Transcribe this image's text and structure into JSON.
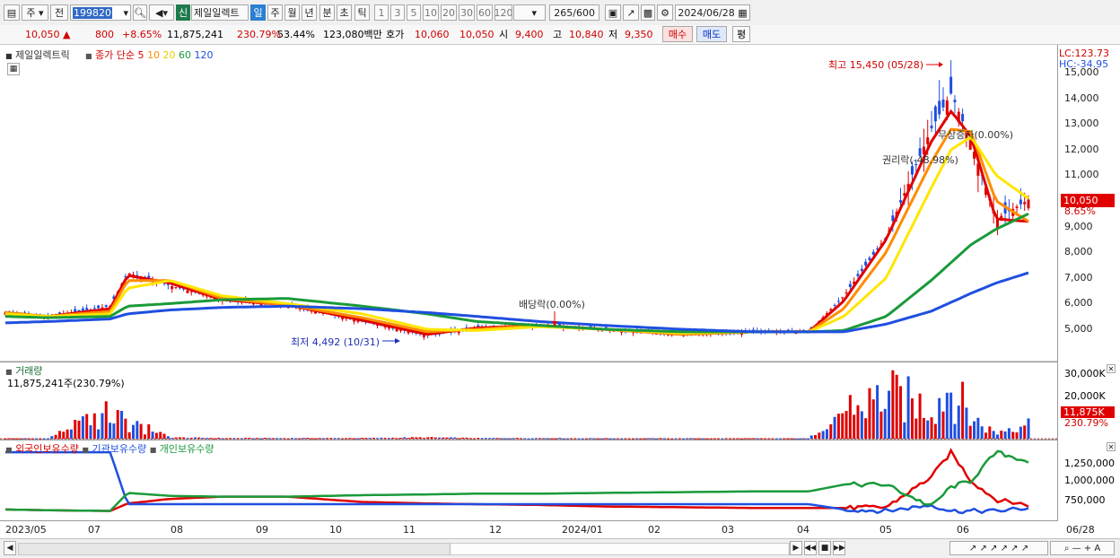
{
  "toolbar": {
    "market": "주",
    "prev_btn": "전",
    "code": "199820",
    "badge": "신",
    "name": "제일일렉트",
    "periods": [
      "일",
      "주",
      "월",
      "년",
      "분",
      "초",
      "틱"
    ],
    "intervals": [
      "1",
      "3",
      "5",
      "10",
      "20",
      "30",
      "60",
      "120"
    ],
    "count": "265",
    "count_max": "/600",
    "date": "2024/06/28"
  },
  "quote": {
    "price": "10,050",
    "change": "800",
    "change_pct": "+8.65%",
    "volume": "11,875,241",
    "vol_ratio": "230.79%",
    "turnover_pct": "53.44%",
    "amount": "123,080백만",
    "bid_label": "호가",
    "bid1": "10,060",
    "bid2": "10,050",
    "open_label": "시",
    "open": "9,400",
    "high_label": "고",
    "high": "10,840",
    "low_label": "저",
    "low": "9,350",
    "buy": "매수",
    "sell": "매도",
    "avg": "평"
  },
  "price_pane": {
    "stock_label": "제일일렉트릭",
    "ma_title": "종가 단순",
    "ma_periods": [
      "5",
      "10",
      "20",
      "60",
      "120"
    ],
    "ma_colors": [
      "#e00000",
      "#ff8c00",
      "#ffe600",
      "#1a9a3a",
      "#1f4fe0"
    ],
    "lc": "LC:123.73",
    "hc": "HC:-34.95",
    "last_price_tag": "10,050",
    "last_pct_tag": "8.65%",
    "high_note": "최고 15,450 (05/28)",
    "low_note": "최저 4,492 (10/31)",
    "div_note": "배당락(0.00%)",
    "free_note": "무상증자(0.00%)",
    "rights_note": "권리락(-48.98%)",
    "yticks": [
      "15,000",
      "14,000",
      "13,000",
      "12,000",
      "11,000",
      "10,000",
      "9,000",
      "8,000",
      "7,000",
      "6,000",
      "5,000"
    ]
  },
  "volume_pane": {
    "title": "거래량",
    "value": "11,875,241주(230.79%)",
    "yticks": [
      "30,000K",
      "20,000K",
      "10,000K"
    ],
    "last_tag": "11,875K",
    "last_pct": "230.79%"
  },
  "holdings_pane": {
    "series": [
      {
        "name": "외국인보유수량",
        "color": "#e00000"
      },
      {
        "name": "기관보유수량",
        "color": "#1f4fe0"
      },
      {
        "name": "개인보유수량",
        "color": "#1a9a3a"
      }
    ],
    "yticks": [
      "1,250,000",
      "1,000,000",
      "750,000"
    ]
  },
  "x_axis": [
    "2023/05",
    "07",
    "08",
    "09",
    "10",
    "11",
    "12",
    "2024/01",
    "02",
    "03",
    "04",
    "05",
    "06",
    "06/28"
  ],
  "chart_data": {
    "type": "candlestick",
    "title": "제일일렉트릭 (199820) 일봉",
    "ylim": [
      4000,
      15700
    ],
    "dates": [
      "2023-05-15",
      "2023-06-01",
      "2023-06-26",
      "2023-07-03",
      "2023-07-20",
      "2023-08-10",
      "2023-09-05",
      "2023-10-05",
      "2023-10-31",
      "2023-11-20",
      "2023-12-15",
      "2024-01-10",
      "2024-02-10",
      "2024-03-10",
      "2024-04-01",
      "2024-04-15",
      "2024-05-02",
      "2024-05-20",
      "2024-05-28",
      "2024-06-05",
      "2024-06-15",
      "2024-06-28"
    ],
    "close": [
      5650,
      5500,
      5900,
      7200,
      6700,
      6150,
      5950,
      5300,
      4750,
      5050,
      5200,
      5000,
      4800,
      4900,
      4900,
      6300,
      8600,
      12800,
      14200,
      12300,
      9300,
      10050
    ],
    "series": [
      {
        "name": "MA5",
        "values": [
          5650,
          5500,
          5800,
          7100,
          6800,
          6150,
          5950,
          5350,
          4800,
          5050,
          5150,
          5000,
          4800,
          4900,
          4900,
          6100,
          8500,
          12300,
          13500,
          12500,
          9300,
          9200
        ]
      },
      {
        "name": "MA10",
        "values": [
          5650,
          5500,
          5700,
          6900,
          6900,
          6200,
          5950,
          5450,
          4900,
          5000,
          5150,
          5000,
          4800,
          4900,
          4900,
          5800,
          8000,
          11500,
          12800,
          12700,
          10000,
          9200
        ]
      },
      {
        "name": "MA20",
        "values": [
          5600,
          5500,
          5600,
          6600,
          6900,
          6300,
          6000,
          5600,
          5000,
          4950,
          5100,
          5000,
          4850,
          4900,
          4900,
          5500,
          7000,
          10500,
          12000,
          12500,
          11000,
          10100
        ]
      },
      {
        "name": "MA60",
        "values": [
          5500,
          5450,
          5500,
          5900,
          6000,
          6150,
          6200,
          5900,
          5600,
          5300,
          5150,
          5000,
          4900,
          4900,
          4900,
          4950,
          5500,
          6900,
          7600,
          8300,
          8900,
          9500
        ]
      },
      {
        "name": "MA120",
        "values": [
          5250,
          5300,
          5400,
          5600,
          5750,
          5850,
          5900,
          5800,
          5650,
          5500,
          5300,
          5150,
          5000,
          4900,
          4900,
          4900,
          5200,
          5700,
          6050,
          6400,
          6800,
          7200
        ]
      }
    ],
    "volume_k": [
      200,
      150,
      14000,
      9000,
      600,
      300,
      300,
      300,
      600,
      300,
      300,
      200,
      200,
      200,
      150,
      13000,
      25000,
      18000,
      30000,
      12000,
      3000,
      11875
    ],
    "holdings": [
      {
        "name": "외국인보유수량",
        "values": [
          620000,
          610000,
          600000,
          700000,
          760000,
          790000,
          790000,
          720000,
          700000,
          690000,
          680000,
          660000,
          650000,
          640000,
          640000,
          640000,
          650000,
          1050000,
          1380000,
          1000000,
          750000,
          680000
        ]
      },
      {
        "name": "기관보유수량",
        "values": [
          1380000,
          1380000,
          1380000,
          690000,
          690000,
          690000,
          690000,
          690000,
          690000,
          690000,
          690000,
          690000,
          690000,
          690000,
          690000,
          620000,
          600000,
          680000,
          600000,
          600000,
          600000,
          640000
        ]
      },
      {
        "name": "개인보유수량",
        "values": [
          620000,
          610000,
          600000,
          840000,
          800000,
          790000,
          790000,
          810000,
          820000,
          830000,
          830000,
          840000,
          850000,
          860000,
          860000,
          950000,
          950000,
          660000,
          920000,
          1000000,
          1380000,
          1260000
        ]
      }
    ]
  }
}
